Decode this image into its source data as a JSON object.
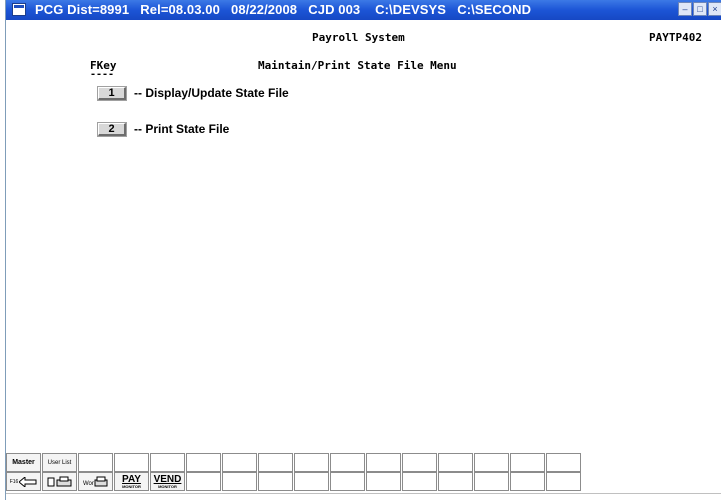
{
  "window": {
    "title": "PCG Dist=8991   Rel=08.03.00   08/22/2008   CJD 003    C:\\DEVSYS   C:\\SECOND",
    "icon": "terminal-window-icon",
    "title_buttons": [
      "minimize",
      "maximize",
      "close"
    ]
  },
  "screen": {
    "system_title": "Payroll System",
    "program_id": "PAYTP402",
    "fkey_header": "FKey",
    "fkey_underline": "----",
    "menu_title": "Maintain/Print State File Menu",
    "options": [
      {
        "key": "1",
        "label": "-- Display/Update State File"
      },
      {
        "key": "2",
        "label": "-- Print State File"
      }
    ]
  },
  "toolbar": {
    "row1": [
      {
        "label": "Master",
        "icon": "master-icon"
      },
      {
        "label": "User List",
        "icon": "user-list-icon"
      }
    ],
    "row2": [
      {
        "label": "F16",
        "icon": "back-arrow-icon"
      },
      {
        "label": "",
        "icon": "print-screen-icon"
      },
      {
        "label": "",
        "icon": "print-work-icon"
      },
      {
        "label": "PAY",
        "sub": "MONITOR",
        "icon": "pay-monitor-icon"
      },
      {
        "label": "VEND",
        "sub": "MONITOR",
        "icon": "vend-monitor-icon"
      }
    ]
  },
  "colors": {
    "titlebar": "#1c55d6",
    "button_face": "#d8d8d8"
  }
}
